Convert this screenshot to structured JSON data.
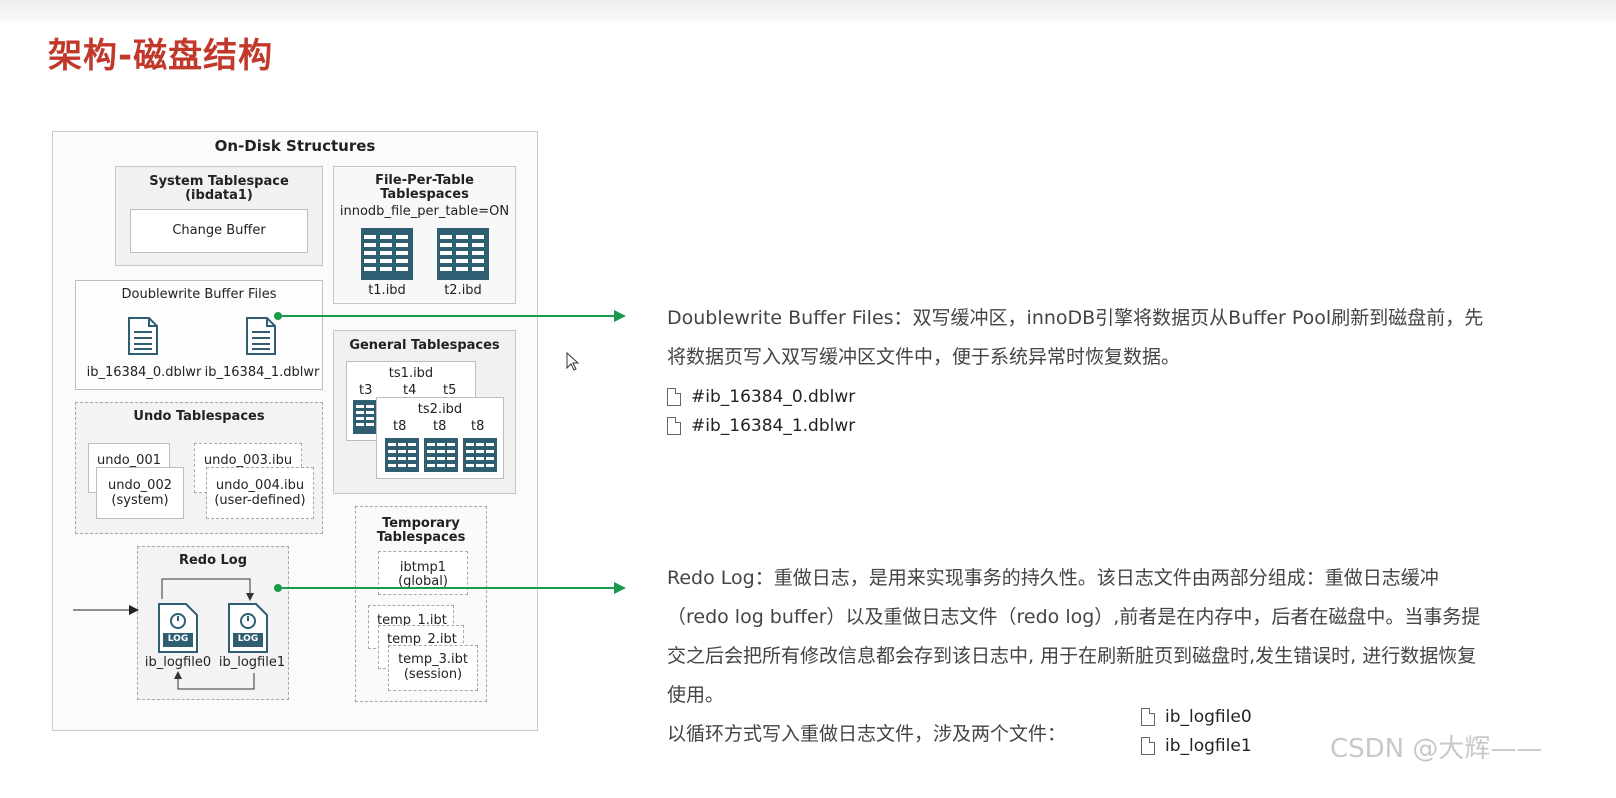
{
  "slide": {
    "title": "架构-磁盘结构"
  },
  "diagram": {
    "title": "On-Disk Structures",
    "system_tablespace": {
      "line1": "System Tablespace",
      "line2": "(ibdata1)",
      "change_buffer": "Change Buffer"
    },
    "file_per_table": {
      "line1": "File-Per-Table",
      "line2": "Tablespaces",
      "setting": "innodb_file_per_table=ON",
      "files": [
        "t1.ibd",
        "t2.ibd"
      ]
    },
    "doublewrite": {
      "title": "Doublewrite Buffer Files",
      "files": [
        "ib_16384_0.dblwr",
        "ib_16384_1.dblwr"
      ]
    },
    "general": {
      "title": "General Tablespaces",
      "ts1": "ts1.ibd",
      "ts1_tables": [
        "t3",
        "t4",
        "t5"
      ],
      "ts2": "ts2.ibd",
      "ts2_tables": [
        "t8",
        "t8",
        "t8"
      ]
    },
    "undo": {
      "title": "Undo Tablespaces",
      "undo_001": "undo_001",
      "undo_002a": "undo_002",
      "undo_002b": "(system)",
      "undo_003": "undo_003.ibu",
      "undo_004a": "undo_004.ibu",
      "undo_004b": "(user-defined)"
    },
    "redo": {
      "title": "Redo Log",
      "files": [
        "ib_logfile0",
        "ib_logfile1"
      ],
      "icon_label": "LOG"
    },
    "temporary": {
      "line1": "Temporary",
      "line2": "Tablespaces",
      "ibtmp1a": "ibtmp1",
      "ibtmp1b": "(global)",
      "temp1": "temp_1.ibt",
      "temp2": "temp_2.ibt",
      "temp3a": "temp_3.ibt",
      "temp3b": "(session)"
    }
  },
  "doublewrite_desc": {
    "line1": "Doublewrite Buffer Files：双写缓冲区，innoDB引擎将数据页从Buffer Pool刷新到磁盘前，先",
    "line2": "将数据页写入双写缓冲区文件中，便于系统异常时恢复数据。",
    "files": [
      "#ib_16384_0.dblwr",
      "#ib_16384_1.dblwr"
    ]
  },
  "redo_desc": {
    "line1": "Redo Log：重做日志，是用来实现事务的持久性。该日志文件由两部分组成：重做日志缓冲",
    "line2": "（redo log buffer）以及重做日志文件（redo log）,前者是在内存中，后者在磁盘中。当事务提",
    "line3": "交之后会把所有修改信息都会存到该日志中, 用于在刷新脏页到磁盘时,发生错误时, 进行数据恢复",
    "line4": "使用。",
    "line5": "以循环方式写入重做日志文件，涉及两个文件：",
    "files": [
      "ib_logfile0",
      "ib_logfile1"
    ]
  },
  "watermark": "CSDN @大辉——",
  "colors": {
    "title": "#c0392b",
    "arrow": "#1a9a4a",
    "table_icon": "#2f5d72"
  }
}
